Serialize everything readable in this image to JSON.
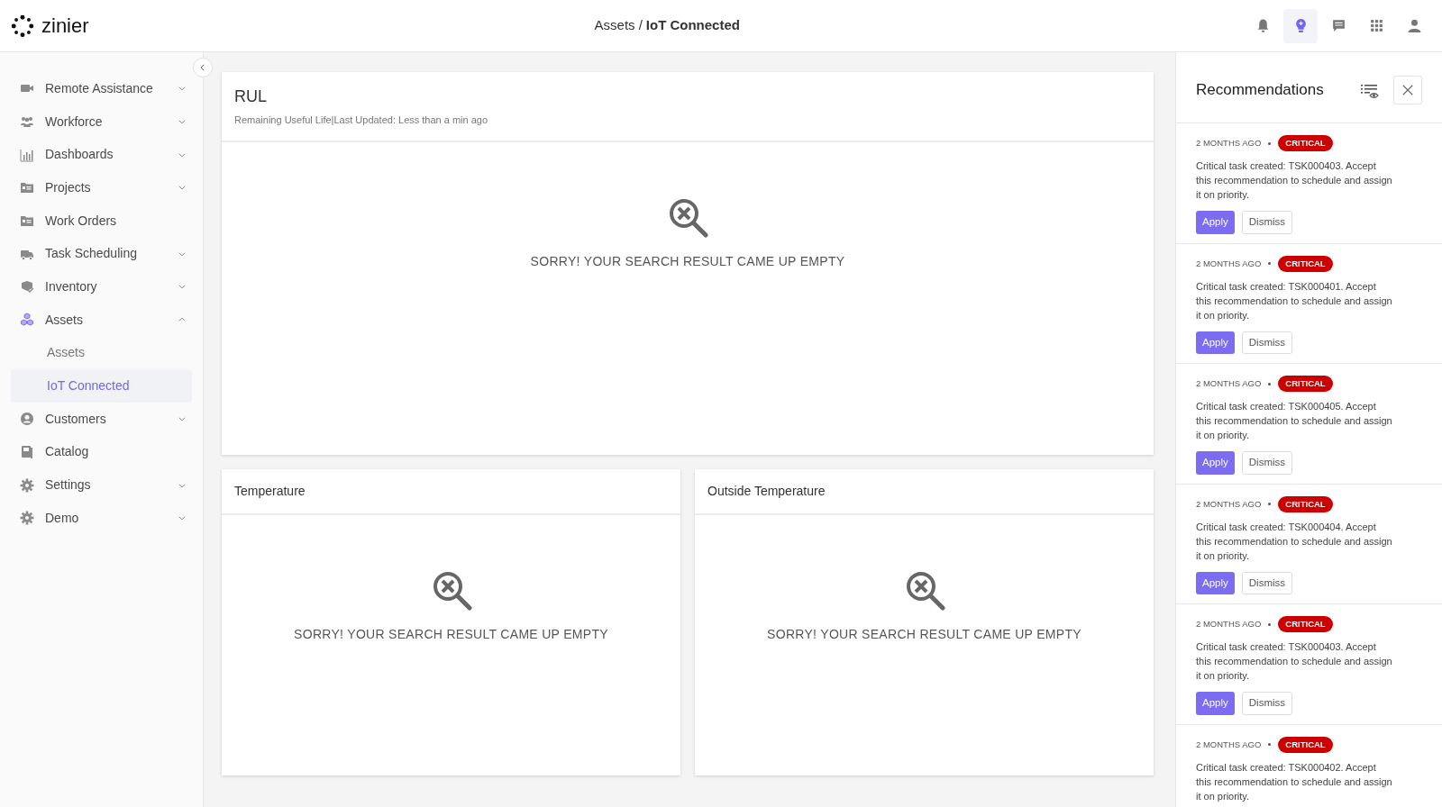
{
  "logo": {
    "text": "zinier"
  },
  "breadcrumb": {
    "parent": "Assets",
    "separator": "/",
    "current": "IoT Connected"
  },
  "top_icons": [
    {
      "kind": "bell",
      "selected": false
    },
    {
      "kind": "bulb",
      "selected": true
    },
    {
      "kind": "chat",
      "selected": false
    },
    {
      "kind": "apps",
      "selected": false
    },
    {
      "kind": "user",
      "selected": false
    }
  ],
  "sidebar": {
    "items": [
      {
        "label": "Remote Assistance",
        "kind": "group",
        "expanded": false
      },
      {
        "label": "Workforce",
        "kind": "group",
        "expanded": false
      },
      {
        "label": "Dashboards",
        "kind": "group",
        "expanded": false
      },
      {
        "label": "Projects",
        "kind": "group",
        "expanded": false
      },
      {
        "label": "Work Orders",
        "kind": "link"
      },
      {
        "label": "Task Scheduling",
        "kind": "group",
        "expanded": false
      },
      {
        "label": "Inventory",
        "kind": "group",
        "expanded": false
      },
      {
        "label": "Assets",
        "kind": "group",
        "expanded": true,
        "children": [
          {
            "label": "Assets",
            "selected": false
          },
          {
            "label": "IoT Connected",
            "selected": true
          }
        ]
      },
      {
        "label": "Customers",
        "kind": "group",
        "expanded": false
      },
      {
        "label": "Catalog",
        "kind": "link"
      },
      {
        "label": "Settings",
        "kind": "group",
        "expanded": false
      },
      {
        "label": "Demo",
        "kind": "group",
        "expanded": false
      }
    ]
  },
  "panels": [
    {
      "title": "RUL",
      "subtitle": "Remaining Useful Life|Last Updated: Less than a min ago",
      "empty_message": "SORRY! YOUR SEARCH RESULT CAME UP EMPTY"
    },
    {
      "title": "Temperature",
      "empty_message": "SORRY! YOUR SEARCH RESULT CAME UP EMPTY"
    },
    {
      "title": "Outside Temperature",
      "empty_message": "SORRY! YOUR SEARCH RESULT CAME UP EMPTY"
    }
  ],
  "recommendations": {
    "title": "Recommendations",
    "items": [
      {
        "time": "2 MONTHS AGO",
        "severity": "CRITICAL",
        "text": "Critical task created: TSK000403. Accept this recommendation to schedule and assign it on priority.",
        "actions": [
          "Apply",
          "Dismiss"
        ]
      },
      {
        "time": "2 MONTHS AGO",
        "severity": "CRITICAL",
        "text": "Critical task created: TSK000401. Accept this recommendation to schedule and assign it on priority.",
        "actions": [
          "Apply",
          "Dismiss"
        ]
      },
      {
        "time": "2 MONTHS AGO",
        "severity": "CRITICAL",
        "text": "Critical task created: TSK000405. Accept this recommendation to schedule and assign it on priority.",
        "actions": [
          "Apply",
          "Dismiss"
        ]
      },
      {
        "time": "2 MONTHS AGO",
        "severity": "CRITICAL",
        "text": "Critical task created: TSK000404. Accept this recommendation to schedule and assign it on priority.",
        "actions": [
          "Apply",
          "Dismiss"
        ]
      },
      {
        "time": "2 MONTHS AGO",
        "severity": "CRITICAL",
        "text": "Critical task created: TSK000403. Accept this recommendation to schedule and assign it on priority.",
        "actions": [
          "Apply",
          "Dismiss"
        ]
      },
      {
        "time": "2 MONTHS AGO",
        "severity": "CRITICAL",
        "text": "Critical task created: TSK000402. Accept this recommendation to schedule and assign it on priority."
      }
    ]
  }
}
